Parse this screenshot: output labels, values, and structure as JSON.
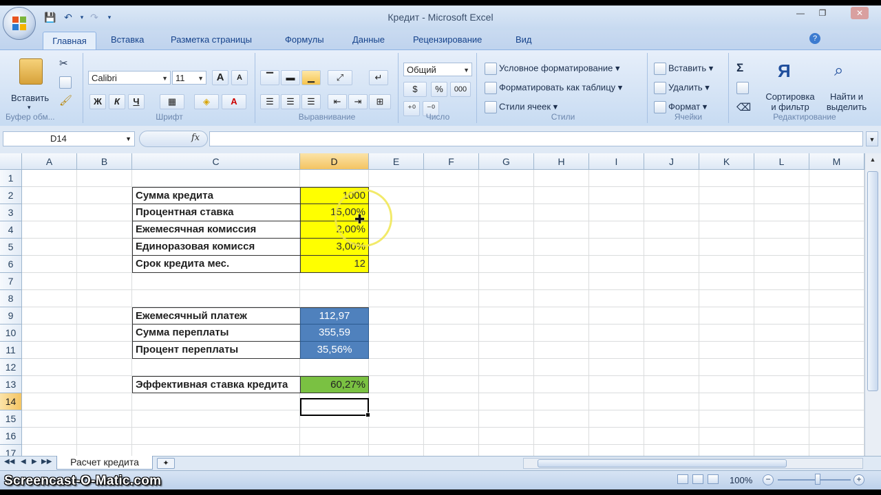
{
  "window": {
    "title": "Кредит - Microsoft Excel",
    "controls": {
      "minimize": "—",
      "restore": "❐",
      "close": "✕"
    }
  },
  "tabs": [
    "Главная",
    "Вставка",
    "Разметка страницы",
    "Формулы",
    "Данные",
    "Рецензирование",
    "Вид"
  ],
  "ribbon": {
    "clipboard": {
      "paste": "Вставить",
      "label": "Буфер обм..."
    },
    "font": {
      "name": "Calibri",
      "size": "11",
      "bold": "Ж",
      "italic": "К",
      "underline": "Ч",
      "grow": "A",
      "shrink": "A",
      "color_letter": "A",
      "label": "Шрифт"
    },
    "alignment": {
      "label": "Выравнивание"
    },
    "number": {
      "format": "Общий",
      "percent": "%",
      "thousands": "000",
      "label": "Число"
    },
    "styles": {
      "conditional": "Условное форматирование",
      "as_table": "Форматировать как таблицу",
      "cell_styles": "Стили ячеек",
      "label": "Стили"
    },
    "cells": {
      "insert": "Вставить",
      "delete": "Удалить",
      "format": "Формат",
      "label": "Ячейки"
    },
    "editing": {
      "sum": "Σ",
      "sort_line1": "Сортировка",
      "sort_line2": "и фильтр",
      "find_line1": "Найти и",
      "find_line2": "выделить",
      "label": "Редактирование"
    }
  },
  "formula_bar": {
    "name_box": "D14",
    "fx": "fx",
    "formula": ""
  },
  "columns": [
    "A",
    "B",
    "C",
    "D",
    "E",
    "F",
    "G",
    "H",
    "I",
    "J",
    "K",
    "L",
    "M"
  ],
  "rows": [
    "1",
    "2",
    "3",
    "4",
    "5",
    "6",
    "7",
    "8",
    "9",
    "10",
    "11",
    "12",
    "13",
    "14",
    "15",
    "16",
    "17"
  ],
  "selected_cell": {
    "col": "D",
    "row": "14"
  },
  "inputs": [
    {
      "label": "Сумма кредита",
      "value": "1000"
    },
    {
      "label": "Процентная ставка",
      "value": "15,00%"
    },
    {
      "label": "Ежемесячная комиссия",
      "value": "2,00%"
    },
    {
      "label": "Единоразовая комисся",
      "value": "3,00%"
    },
    {
      "label": "Срок кредита мес.",
      "value": "12"
    }
  ],
  "results": [
    {
      "label": "Ежемесячный платеж",
      "value": "112,97"
    },
    {
      "label": "Сумма переплаты",
      "value": "355,59"
    },
    {
      "label": "Процент переплаты",
      "value": "35,56%"
    }
  ],
  "effective": {
    "label": "Эффективная ставка кредита",
    "value": "60,27%"
  },
  "sheet_tabs": {
    "active": "Расчет кредита"
  },
  "status": {
    "zoom": "100%",
    "watermark": "Screencast-O-Matic.com"
  },
  "colors": {
    "input_fill": "#ffff00",
    "result_fill": "#4f81bd",
    "effective_fill": "#7ac142",
    "selection_header": "#f4c462"
  }
}
